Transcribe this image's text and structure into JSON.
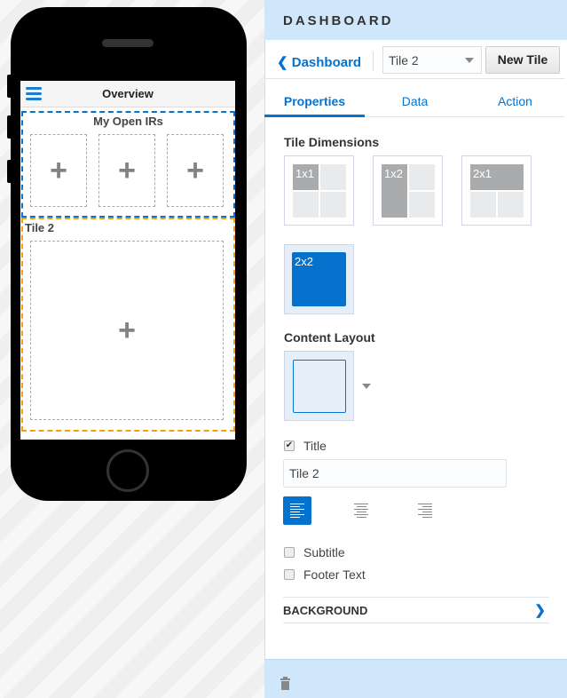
{
  "phone": {
    "screen_title": "Overview",
    "tile1_title": "My Open IRs",
    "tile2_title": "Tile 2",
    "add_icon": "+"
  },
  "panel": {
    "header": "DASHBOARD",
    "back_label": "Dashboard",
    "tile_select": "Tile 2",
    "new_tile_label": "New Tile",
    "tabs": [
      {
        "label": "Properties",
        "active": true
      },
      {
        "label": "Data"
      },
      {
        "label": "Action"
      }
    ],
    "tile_dimensions_label": "Tile Dimensions",
    "dimensions": [
      "1x1",
      "1x2",
      "2x1",
      "2x2"
    ],
    "selected_dimension": "2x2",
    "content_layout_label": "Content Layout",
    "title_checkbox": {
      "label": "Title",
      "checked": true
    },
    "title_value": "Tile 2",
    "alignment": {
      "options": [
        "left",
        "center",
        "right"
      ],
      "selected": "left"
    },
    "subtitle_checkbox": {
      "label": "Subtitle",
      "checked": false
    },
    "footer_checkbox": {
      "label": "Footer Text",
      "checked": false
    },
    "background_label": "BACKGROUND",
    "colors": {
      "accent": "#0572ce",
      "header_bg": "#d0e7fb",
      "tile1_border": "#0572ce",
      "tile2_border": "#f5a000"
    }
  }
}
